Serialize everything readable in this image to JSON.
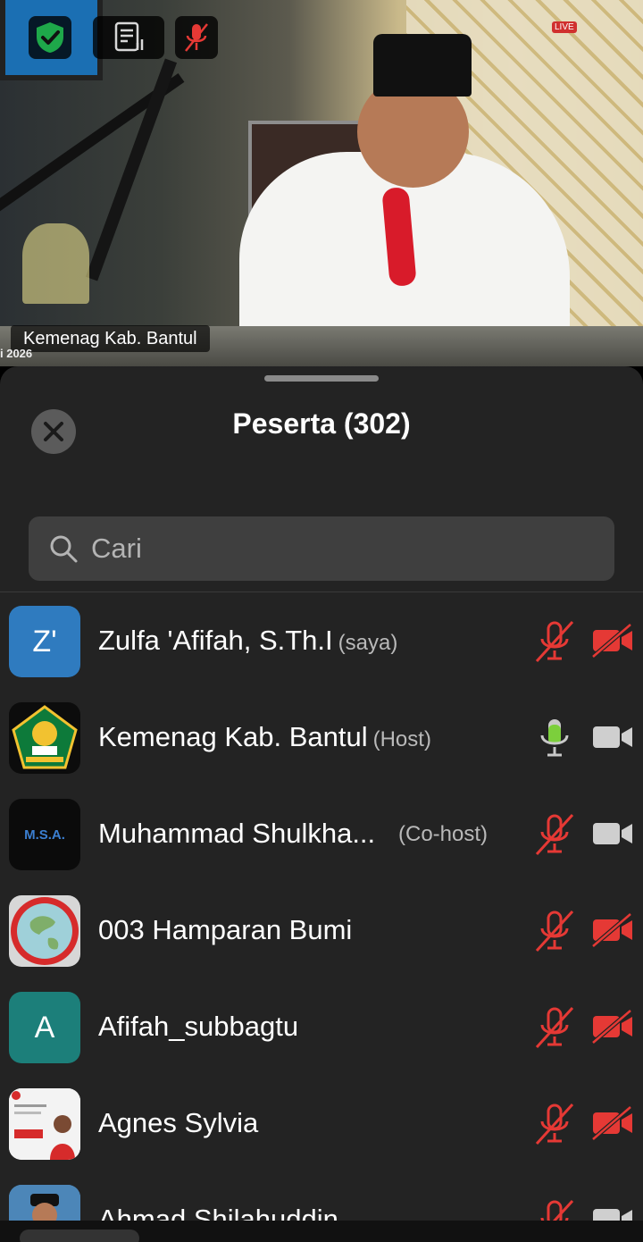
{
  "video": {
    "speaker_name": "Kemenag Kab. Bantul",
    "date_fragment": "i 2026",
    "live_badge": "LIVE"
  },
  "panel": {
    "title": "Peserta (302)",
    "search_placeholder": "Cari"
  },
  "colors": {
    "sheet_bg": "#232323",
    "muted_red": "#e53935",
    "mic_active_green": "#7ccf3c",
    "shield_green": "#1ea84a"
  },
  "participants": [
    {
      "name": "Zulfa 'Afifah, S.Th.I",
      "role": "(saya)",
      "avatar_text": "Z'",
      "avatar_color": "#2f7bbf",
      "mic": "muted",
      "video": "off"
    },
    {
      "name": "Kemenag Kab. Bantul",
      "role": "(Host)",
      "avatar_text": "",
      "avatar_color": "#0c0c0c",
      "mic": "speaking",
      "video": "on"
    },
    {
      "name": "Muhammad Shulkha...",
      "role": "(Co-host)",
      "avatar_text": "M.S.A.",
      "avatar_color": "#0b0b0b",
      "mic": "muted",
      "video": "on"
    },
    {
      "name": "003 Hamparan Bumi",
      "role": "",
      "avatar_text": "",
      "avatar_color": "#d7d7d7",
      "mic": "muted",
      "video": "off"
    },
    {
      "name": "Afifah_subbagtu",
      "role": "",
      "avatar_text": "A",
      "avatar_color": "#1c7f7a",
      "mic": "muted",
      "video": "off"
    },
    {
      "name": "Agnes Sylvia",
      "role": "",
      "avatar_text": "",
      "avatar_color": "#f3f3f3",
      "mic": "muted",
      "video": "off"
    },
    {
      "name": "Ahmad Shilahuddin",
      "role": "",
      "avatar_text": "",
      "avatar_color": "#4c86b8",
      "mic": "muted",
      "video": "on"
    }
  ]
}
